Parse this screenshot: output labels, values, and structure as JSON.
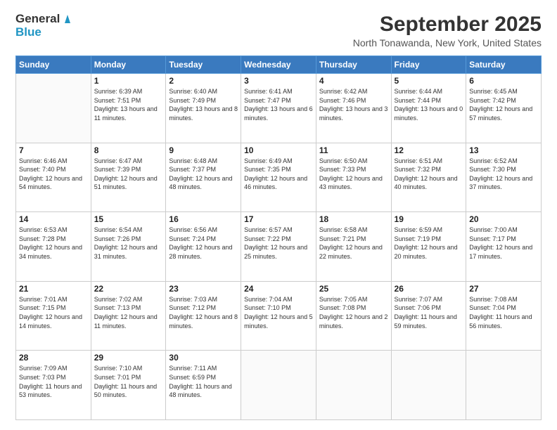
{
  "logo": {
    "line1": "General",
    "line2": "Blue"
  },
  "title": "September 2025",
  "location": "North Tonawanda, New York, United States",
  "days_of_week": [
    "Sunday",
    "Monday",
    "Tuesday",
    "Wednesday",
    "Thursday",
    "Friday",
    "Saturday"
  ],
  "weeks": [
    [
      {
        "day": "",
        "sunrise": "",
        "sunset": "",
        "daylight": ""
      },
      {
        "day": "1",
        "sunrise": "Sunrise: 6:39 AM",
        "sunset": "Sunset: 7:51 PM",
        "daylight": "Daylight: 13 hours and 11 minutes."
      },
      {
        "day": "2",
        "sunrise": "Sunrise: 6:40 AM",
        "sunset": "Sunset: 7:49 PM",
        "daylight": "Daylight: 13 hours and 8 minutes."
      },
      {
        "day": "3",
        "sunrise": "Sunrise: 6:41 AM",
        "sunset": "Sunset: 7:47 PM",
        "daylight": "Daylight: 13 hours and 6 minutes."
      },
      {
        "day": "4",
        "sunrise": "Sunrise: 6:42 AM",
        "sunset": "Sunset: 7:46 PM",
        "daylight": "Daylight: 13 hours and 3 minutes."
      },
      {
        "day": "5",
        "sunrise": "Sunrise: 6:44 AM",
        "sunset": "Sunset: 7:44 PM",
        "daylight": "Daylight: 13 hours and 0 minutes."
      },
      {
        "day": "6",
        "sunrise": "Sunrise: 6:45 AM",
        "sunset": "Sunset: 7:42 PM",
        "daylight": "Daylight: 12 hours and 57 minutes."
      }
    ],
    [
      {
        "day": "7",
        "sunrise": "Sunrise: 6:46 AM",
        "sunset": "Sunset: 7:40 PM",
        "daylight": "Daylight: 12 hours and 54 minutes."
      },
      {
        "day": "8",
        "sunrise": "Sunrise: 6:47 AM",
        "sunset": "Sunset: 7:39 PM",
        "daylight": "Daylight: 12 hours and 51 minutes."
      },
      {
        "day": "9",
        "sunrise": "Sunrise: 6:48 AM",
        "sunset": "Sunset: 7:37 PM",
        "daylight": "Daylight: 12 hours and 48 minutes."
      },
      {
        "day": "10",
        "sunrise": "Sunrise: 6:49 AM",
        "sunset": "Sunset: 7:35 PM",
        "daylight": "Daylight: 12 hours and 46 minutes."
      },
      {
        "day": "11",
        "sunrise": "Sunrise: 6:50 AM",
        "sunset": "Sunset: 7:33 PM",
        "daylight": "Daylight: 12 hours and 43 minutes."
      },
      {
        "day": "12",
        "sunrise": "Sunrise: 6:51 AM",
        "sunset": "Sunset: 7:32 PM",
        "daylight": "Daylight: 12 hours and 40 minutes."
      },
      {
        "day": "13",
        "sunrise": "Sunrise: 6:52 AM",
        "sunset": "Sunset: 7:30 PM",
        "daylight": "Daylight: 12 hours and 37 minutes."
      }
    ],
    [
      {
        "day": "14",
        "sunrise": "Sunrise: 6:53 AM",
        "sunset": "Sunset: 7:28 PM",
        "daylight": "Daylight: 12 hours and 34 minutes."
      },
      {
        "day": "15",
        "sunrise": "Sunrise: 6:54 AM",
        "sunset": "Sunset: 7:26 PM",
        "daylight": "Daylight: 12 hours and 31 minutes."
      },
      {
        "day": "16",
        "sunrise": "Sunrise: 6:56 AM",
        "sunset": "Sunset: 7:24 PM",
        "daylight": "Daylight: 12 hours and 28 minutes."
      },
      {
        "day": "17",
        "sunrise": "Sunrise: 6:57 AM",
        "sunset": "Sunset: 7:22 PM",
        "daylight": "Daylight: 12 hours and 25 minutes."
      },
      {
        "day": "18",
        "sunrise": "Sunrise: 6:58 AM",
        "sunset": "Sunset: 7:21 PM",
        "daylight": "Daylight: 12 hours and 22 minutes."
      },
      {
        "day": "19",
        "sunrise": "Sunrise: 6:59 AM",
        "sunset": "Sunset: 7:19 PM",
        "daylight": "Daylight: 12 hours and 20 minutes."
      },
      {
        "day": "20",
        "sunrise": "Sunrise: 7:00 AM",
        "sunset": "Sunset: 7:17 PM",
        "daylight": "Daylight: 12 hours and 17 minutes."
      }
    ],
    [
      {
        "day": "21",
        "sunrise": "Sunrise: 7:01 AM",
        "sunset": "Sunset: 7:15 PM",
        "daylight": "Daylight: 12 hours and 14 minutes."
      },
      {
        "day": "22",
        "sunrise": "Sunrise: 7:02 AM",
        "sunset": "Sunset: 7:13 PM",
        "daylight": "Daylight: 12 hours and 11 minutes."
      },
      {
        "day": "23",
        "sunrise": "Sunrise: 7:03 AM",
        "sunset": "Sunset: 7:12 PM",
        "daylight": "Daylight: 12 hours and 8 minutes."
      },
      {
        "day": "24",
        "sunrise": "Sunrise: 7:04 AM",
        "sunset": "Sunset: 7:10 PM",
        "daylight": "Daylight: 12 hours and 5 minutes."
      },
      {
        "day": "25",
        "sunrise": "Sunrise: 7:05 AM",
        "sunset": "Sunset: 7:08 PM",
        "daylight": "Daylight: 12 hours and 2 minutes."
      },
      {
        "day": "26",
        "sunrise": "Sunrise: 7:07 AM",
        "sunset": "Sunset: 7:06 PM",
        "daylight": "Daylight: 11 hours and 59 minutes."
      },
      {
        "day": "27",
        "sunrise": "Sunrise: 7:08 AM",
        "sunset": "Sunset: 7:04 PM",
        "daylight": "Daylight: 11 hours and 56 minutes."
      }
    ],
    [
      {
        "day": "28",
        "sunrise": "Sunrise: 7:09 AM",
        "sunset": "Sunset: 7:03 PM",
        "daylight": "Daylight: 11 hours and 53 minutes."
      },
      {
        "day": "29",
        "sunrise": "Sunrise: 7:10 AM",
        "sunset": "Sunset: 7:01 PM",
        "daylight": "Daylight: 11 hours and 50 minutes."
      },
      {
        "day": "30",
        "sunrise": "Sunrise: 7:11 AM",
        "sunset": "Sunset: 6:59 PM",
        "daylight": "Daylight: 11 hours and 48 minutes."
      },
      {
        "day": "",
        "sunrise": "",
        "sunset": "",
        "daylight": ""
      },
      {
        "day": "",
        "sunrise": "",
        "sunset": "",
        "daylight": ""
      },
      {
        "day": "",
        "sunrise": "",
        "sunset": "",
        "daylight": ""
      },
      {
        "day": "",
        "sunrise": "",
        "sunset": "",
        "daylight": ""
      }
    ]
  ]
}
